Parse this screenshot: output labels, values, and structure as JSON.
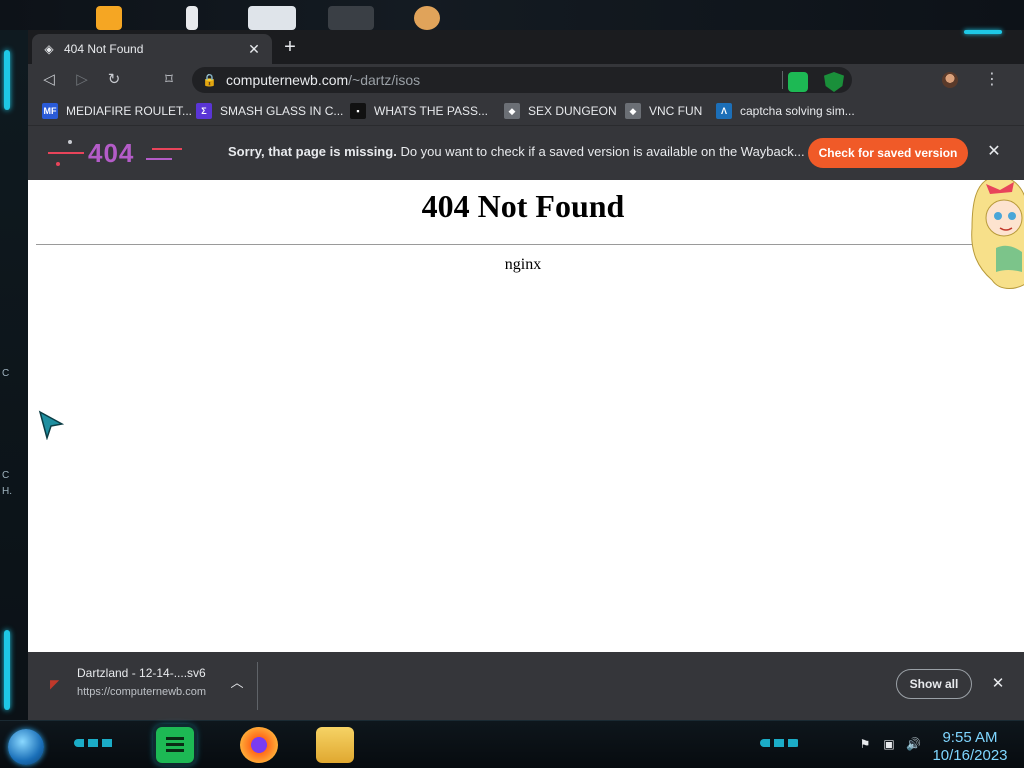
{
  "colors": {
    "accent_cyan": "#1ec8e6",
    "wayback_button": "#f05a28",
    "chrome_dark": "#202124",
    "chrome_surface": "#35363a"
  },
  "desktop": {
    "left_text_1": "C",
    "left_text_2": "C",
    "left_text_3": "H."
  },
  "browser": {
    "tab": {
      "favicon": "nginx-icon",
      "title": "404 Not Found",
      "close_icon": "close-icon"
    },
    "new_tab_icon": "plus-icon",
    "toolbar": {
      "back_icon": "back-icon",
      "forward_icon": "forward-icon",
      "reload_icon": "reload-icon",
      "bookmark_icon": "bookmark-icon",
      "url_host": "computernewb.com",
      "url_path": "/~dartz/isos",
      "menu_icon": "kebab-menu-icon"
    },
    "bookmarks": [
      {
        "label": "MEDIAFIRE ROULET...",
        "icon": "MF",
        "color": "#2a5bd7"
      },
      {
        "label": "SMASH GLASS IN C...",
        "icon": "Σ",
        "color": "#5a35d6"
      },
      {
        "label": "WHATS THE PASS...",
        "icon": "▪",
        "color": "#111111"
      },
      {
        "label": "SEX DUNGEON",
        "icon": "◆",
        "color": "#6b6f75"
      },
      {
        "label": "VNC FUN",
        "icon": "◆",
        "color": "#6b6f75"
      },
      {
        "label": "captcha solving sim...",
        "icon": "Λ",
        "color": "#1c6fb8"
      }
    ],
    "wayback": {
      "logo_text": "404",
      "message_bold": "Sorry, that page is missing.",
      "message_rest": "Do you want to check if a saved version is available on the Wayback...",
      "button": "Check for saved version"
    },
    "page": {
      "heading": "404 Not Found",
      "server": "nginx"
    },
    "downloads": {
      "file_name": "Dartzland - 12-14-....sv6",
      "file_url": "https://computernewb.com",
      "show_all": "Show all"
    }
  },
  "taskbar": {
    "time": "9:55 AM",
    "date": "10/16/2023"
  }
}
